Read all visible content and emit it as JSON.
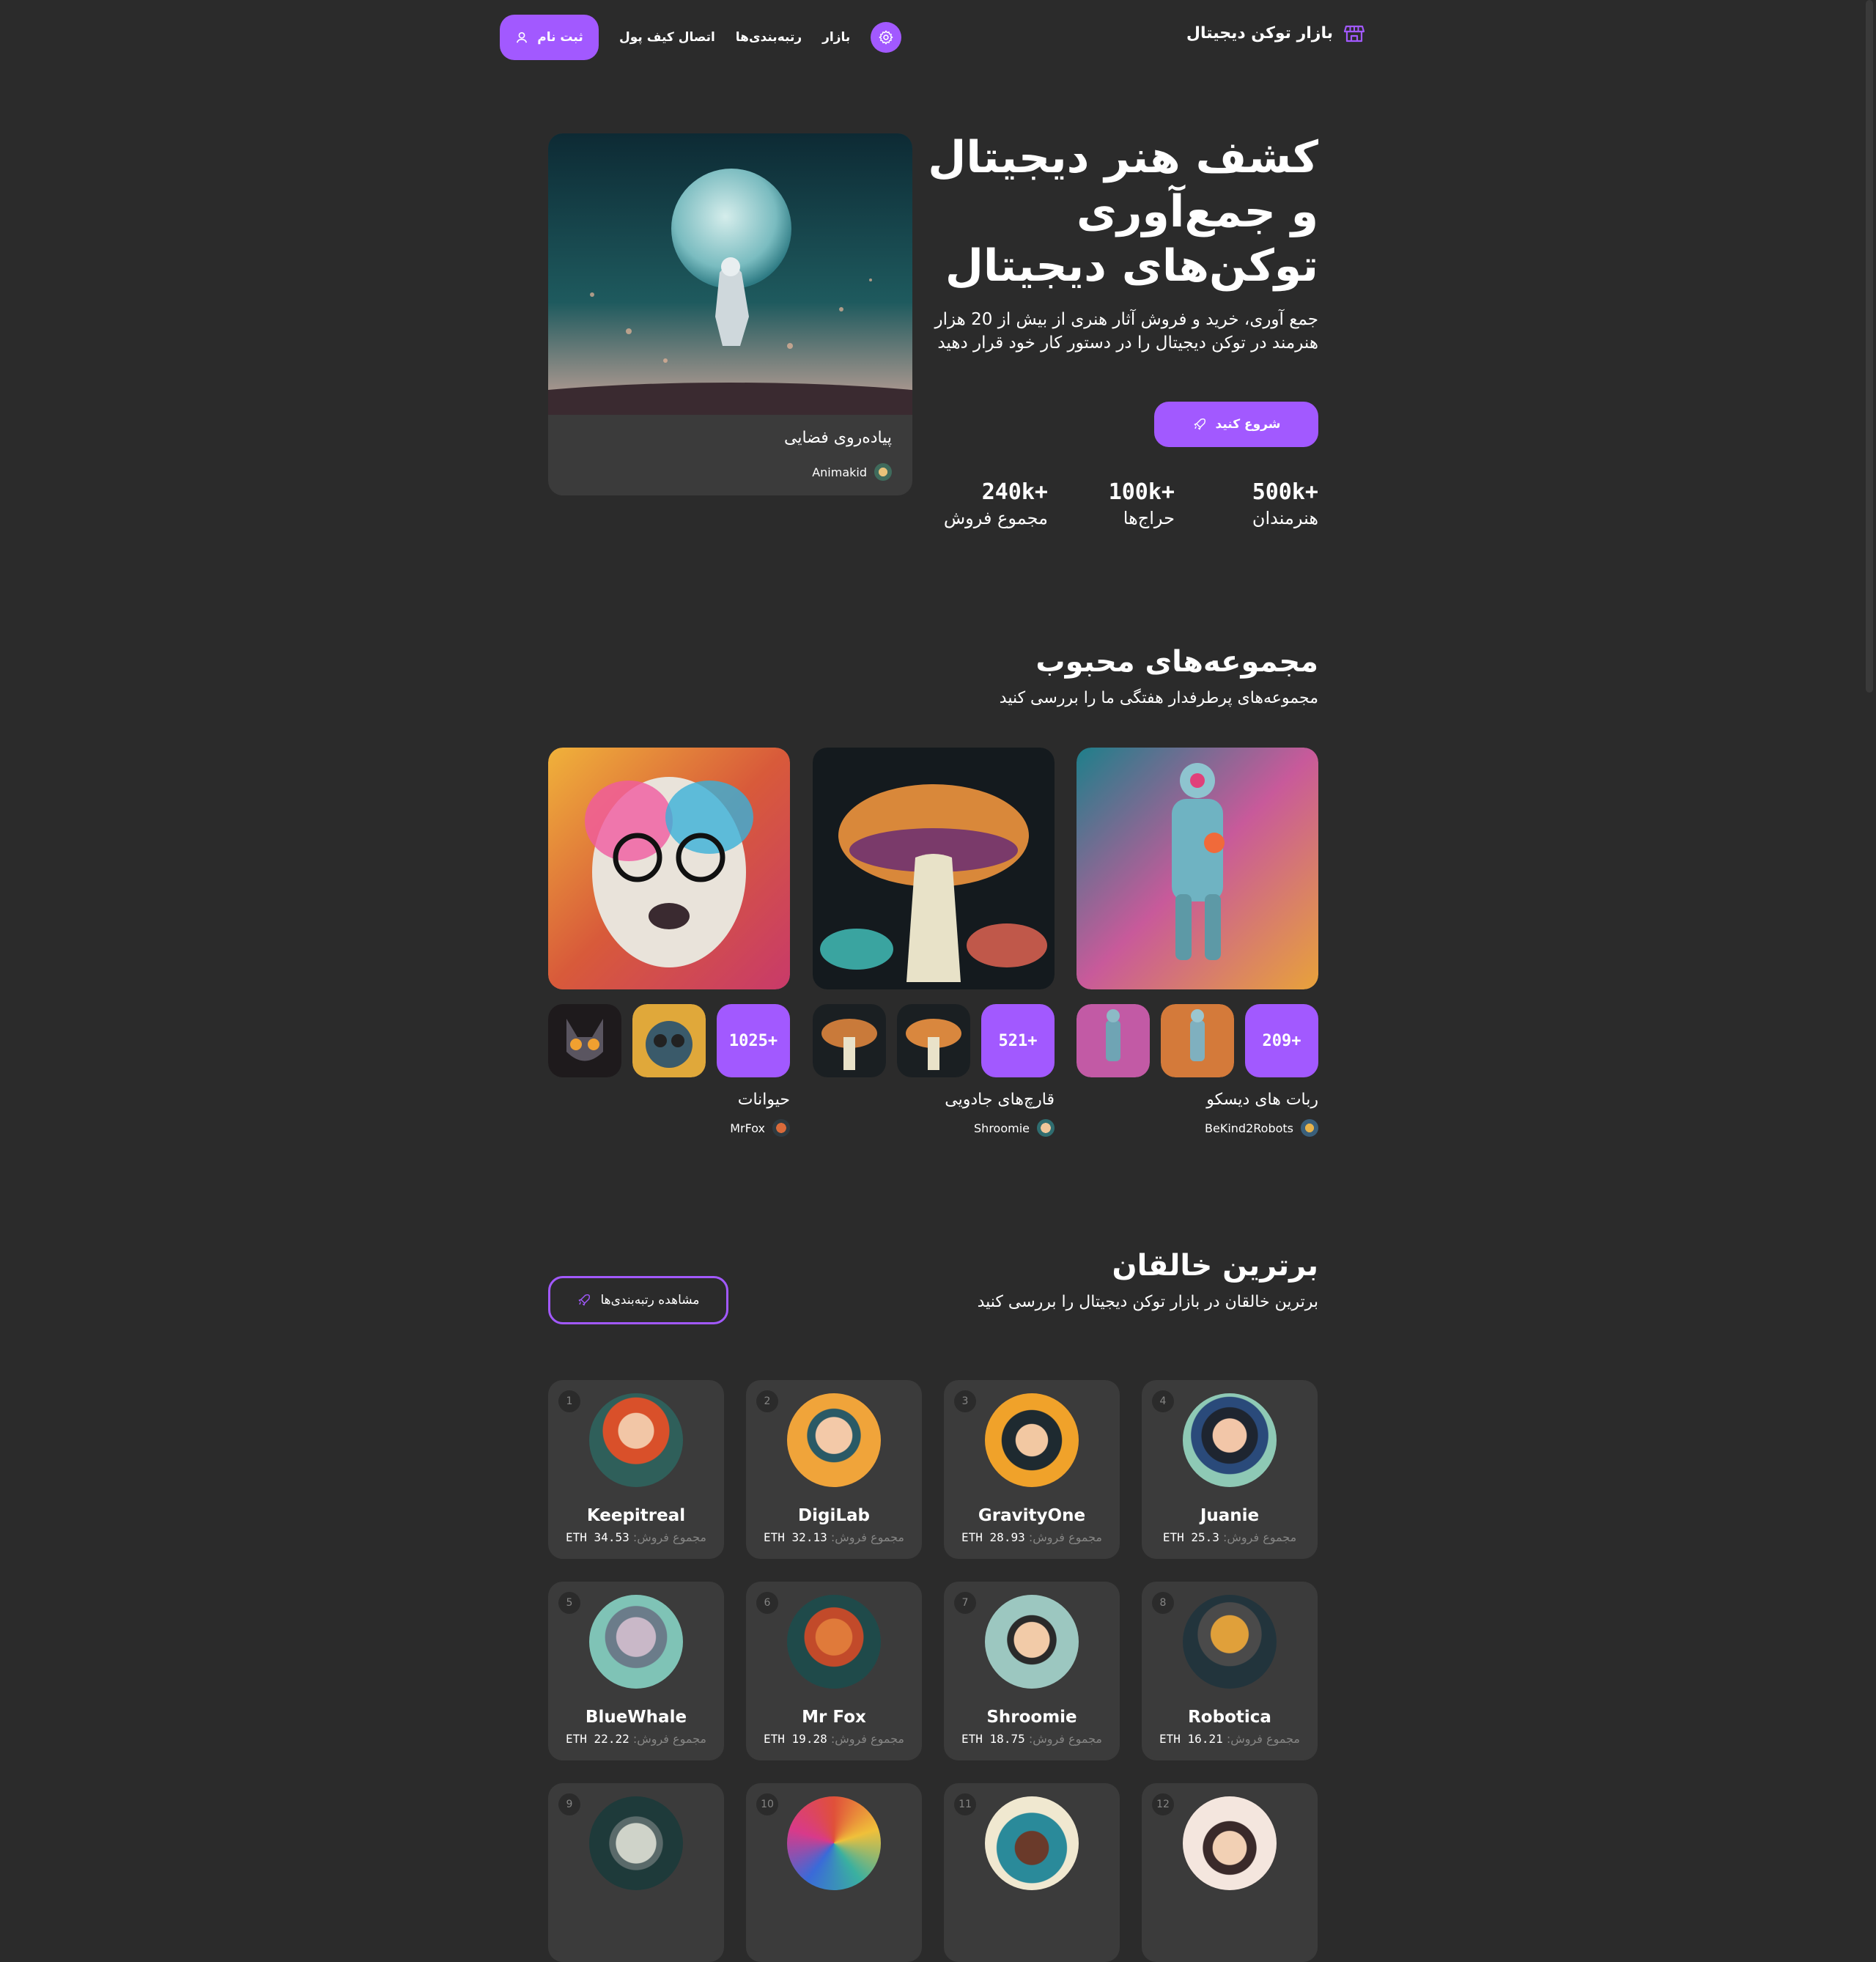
{
  "nav": {
    "brand": "بازار توکن دیجیتال",
    "links": [
      "بازار",
      "رتبه‌بندی‌ها",
      "اتصال کیف پول"
    ],
    "signup": "ثبت نام"
  },
  "hero": {
    "title": "کشف هنر دیجیتال و جمع‌آوری توکن‌های دیجیتال",
    "subtitle": "جمع آوری، خرید و فروش آثار هنری از بیش از 20 هزار هنرمند در توکن دیجیتال را در دستور کار خود قرار دهید",
    "cta": "شروع کنید",
    "stats": [
      {
        "value": "240k+",
        "label": "مجموع فروش"
      },
      {
        "value": "100k+",
        "label": "حراج‌ها"
      },
      {
        "value": "500k+",
        "label": "هنرمندان"
      }
    ],
    "card": {
      "title": "پیاده‌روی فضایی",
      "artist": "Animakid"
    }
  },
  "collections": {
    "title": "مجموعه‌های محبوب",
    "subtitle": "مجموعه‌های پرطرفدار هفتگی ما را بررسی کنید",
    "items": [
      {
        "name": "ربات های دیسکو",
        "artist": "BeKind2Robots",
        "count": "209+"
      },
      {
        "name": "قارچ‌های جادویی",
        "artist": "Shroomie",
        "count": "521+"
      },
      {
        "name": "حیوانات",
        "artist": "MrFox",
        "count": "1025+"
      }
    ]
  },
  "creators": {
    "title": "برترین خالقان",
    "subtitle": "برترین خالقان در بازار توکن دیجیتال را بررسی کنید",
    "view_rankings": "مشاهده رتبه‌بندی‌ها",
    "sales_label": "مجموع فروش:",
    "list": [
      {
        "rank": "1",
        "name": "Keepitreal",
        "sales": "34.53 ETH"
      },
      {
        "rank": "2",
        "name": "DigiLab",
        "sales": "32.13 ETH"
      },
      {
        "rank": "3",
        "name": "GravityOne",
        "sales": "28.93 ETH"
      },
      {
        "rank": "4",
        "name": "Juanie",
        "sales": "25.3 ETH"
      },
      {
        "rank": "5",
        "name": "BlueWhale",
        "sales": "22.22 ETH"
      },
      {
        "rank": "6",
        "name": "Mr Fox",
        "sales": "19.28 ETH"
      },
      {
        "rank": "7",
        "name": "Shroomie",
        "sales": "18.75 ETH"
      },
      {
        "rank": "8",
        "name": "Robotica",
        "sales": "16.21 ETH"
      },
      {
        "rank": "9",
        "name": "",
        "sales": ""
      },
      {
        "rank": "10",
        "name": "",
        "sales": ""
      },
      {
        "rank": "11",
        "name": "",
        "sales": ""
      },
      {
        "rank": "12",
        "name": "",
        "sales": ""
      }
    ]
  },
  "colors": {
    "accent": "#a259ff",
    "background": "#2b2b2b",
    "card": "#3b3b3b",
    "muted": "#858584"
  }
}
